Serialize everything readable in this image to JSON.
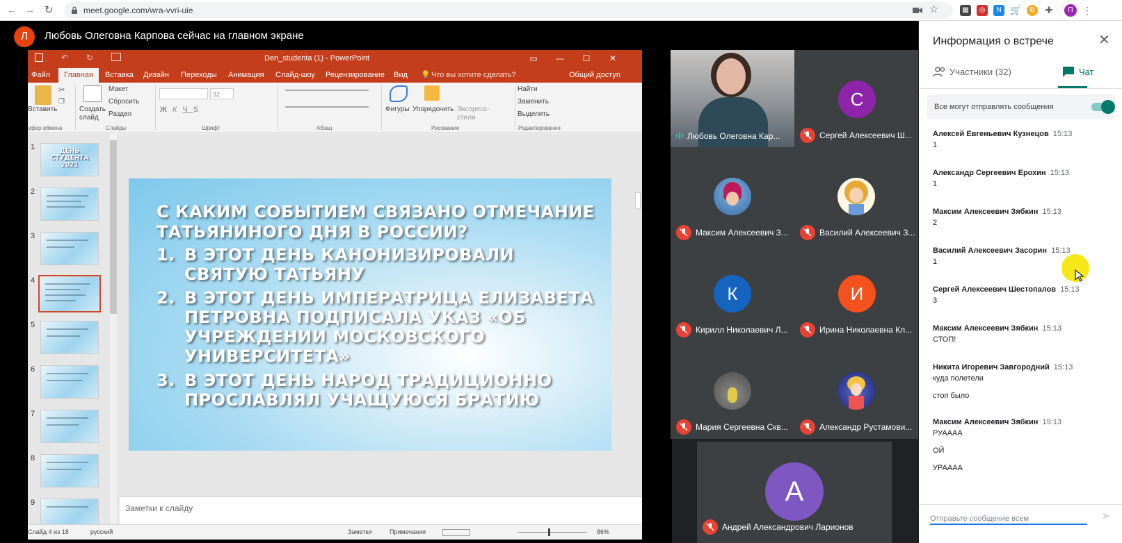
{
  "browser": {
    "url": "meet.google.com/wra-vvri-uie",
    "profile_letter": "П"
  },
  "presenter": {
    "avatar_letter": "Л",
    "banner": "Любовь Олеговна Карпова сейчас на главном экране"
  },
  "ppt": {
    "title": "Den_studenta (1) - PowerPoint",
    "tabs": [
      "Файл",
      "Главная",
      "Вставка",
      "Дизайн",
      "Переходы",
      "Анимация",
      "Слайд-шоу",
      "Рецензирование",
      "Вид"
    ],
    "tell_me": "Что вы хотите сделать?",
    "share": "Общий доступ",
    "ribbon": {
      "paste": "Вставить",
      "clipboard": "уфер обмена",
      "layout": "Макет",
      "reset": "Сбросить",
      "new_slide": "Создать слайд",
      "section": "Раздел",
      "slides": "Слайды",
      "font_size": "32",
      "font": "Шрифт",
      "paragraph": "Абзац",
      "shapes": "Фигуры",
      "arrange": "Упорядочить",
      "quick_styles": "Экспресс-стили",
      "drawing": "Рисование",
      "find": "Найти",
      "replace": "Заменить",
      "select": "Выделить",
      "editing": "Редактирование"
    },
    "thumb_numbers": [
      "1",
      "2",
      "3",
      "4",
      "5",
      "6",
      "7",
      "8",
      "9"
    ],
    "thumb1_text": "ДЕНЬ СТУДЕНТА 2021",
    "slide": {
      "title": "С КАКИМ СОБЫТИЕМ СВЯЗАНО ОТМЕЧАНИЕ ТАТЬЯНИНОГО ДНЯ В РОССИИ?",
      "items": [
        {
          "num": "1.",
          "text": "В ЭТОТ ДЕНЬ КАНОНИЗИРОВАЛИ СВЯТУЮ ТАТЬЯНУ"
        },
        {
          "num": "2.",
          "text": "В ЭТОТ ДЕНЬ ИМПЕРАТРИЦА ЕЛИЗАВЕТА ПЕТРОВНА ПОДПИСАЛА УКАЗ «ОБ УЧРЕЖДЕНИИ МОСКОВСКОГО УНИВЕРСИТЕТА»"
        },
        {
          "num": "3.",
          "text": "В ЭТОТ ДЕНЬ НАРОД ТРАДИЦИОННО ПРОСЛАВЛЯЛ УЧАЩУЮСЯ БРАТИЮ"
        }
      ]
    },
    "notes_placeholder": "Заметки к слайду",
    "status": {
      "slide_of": "Слайд 4 из 18",
      "lang": "русский",
      "notes": "Заметки",
      "comments": "Примечания",
      "zoom": "86%"
    }
  },
  "tiles": [
    {
      "name": "Любовь Олеговна Кар...",
      "type": "video"
    },
    {
      "name": "Сергей Алексеевич Ш...",
      "letter": "С",
      "color": "#8e24aa"
    },
    {
      "name": "Максим Алексеевич З...",
      "type": "avatar"
    },
    {
      "name": "Василий Алексеевич З...",
      "type": "avatar"
    },
    {
      "name": "Кирилл Николаевич Л...",
      "letter": "К",
      "color": "#1565c0"
    },
    {
      "name": "Ирина Николаевна Кл...",
      "letter": "И",
      "color": "#f4511e"
    },
    {
      "name": "Мария Сергеевна Скв...",
      "type": "avatar"
    },
    {
      "name": "Александр Рустамови...",
      "type": "avatar"
    },
    {
      "name": "Андрей Александрович Ларионов",
      "letter": "А",
      "color": "#7e57c2"
    }
  ],
  "panel": {
    "title": "Информация о встрече",
    "tab_people": "Участники (32)",
    "tab_chat": "Чат",
    "toggle_label": "Все могут отправлять сообщения",
    "messages": [
      {
        "name": "Алексей Евгеньевич Кузнецов",
        "time": "15:13",
        "lines": [
          "1"
        ]
      },
      {
        "name": "Александр Сергеевич Ерохин",
        "time": "15:13",
        "lines": [
          "1"
        ]
      },
      {
        "name": "Максим Алексеевич Зябкин",
        "time": "15:13",
        "lines": [
          "2"
        ]
      },
      {
        "name": "Василий Алексеевич Засорин",
        "time": "15:13",
        "lines": [
          "1"
        ]
      },
      {
        "name": "Сергей Алексеевич Шестопалов",
        "time": "15:13",
        "lines": [
          "3"
        ]
      },
      {
        "name": "Максим Алексеевич Зябкин",
        "time": "15:13",
        "lines": [
          "СТОП!"
        ]
      },
      {
        "name": "Никита Игоревич Завгородний",
        "time": "15:13",
        "lines": [
          "куда полетели",
          "стоп было"
        ]
      },
      {
        "name": "Максим Алексеевич Зябкин",
        "time": "15:13",
        "lines": [
          "РУАААА",
          "ОЙ",
          "УРАААА"
        ]
      }
    ],
    "input_placeholder": "Отправьте сообщение всем"
  },
  "colors": {
    "meet_teal": "#00796b",
    "mute_red": "#ea4335",
    "ppt_orange": "#c43e1c",
    "cursor_highlight": "#f5e400"
  }
}
